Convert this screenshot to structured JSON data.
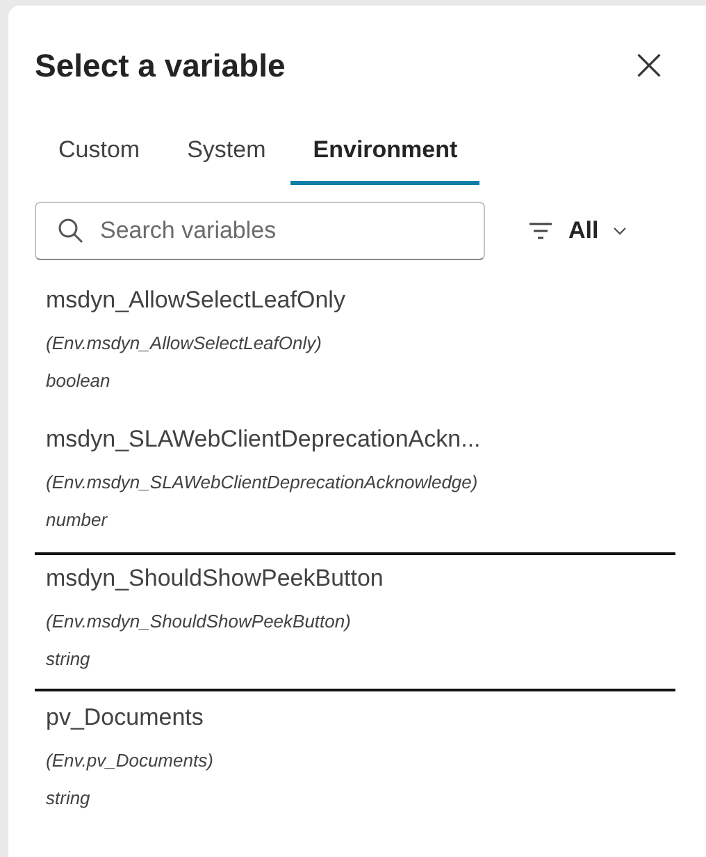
{
  "dialog": {
    "title": "Select a variable"
  },
  "tabs": [
    {
      "label": "Custom",
      "selected": false
    },
    {
      "label": "System",
      "selected": false
    },
    {
      "label": "Environment",
      "selected": true
    }
  ],
  "search": {
    "placeholder": "Search variables"
  },
  "filter": {
    "label": "All"
  },
  "variables": [
    {
      "name": "msdyn_AllowSelectLeafOnly",
      "reference": "(Env.msdyn_AllowSelectLeafOnly)",
      "type": "boolean",
      "selected": false
    },
    {
      "name": "msdyn_SLAWebClientDeprecationAckn...",
      "reference": "(Env.msdyn_SLAWebClientDeprecationAcknowledge)",
      "type": "number",
      "selected": false
    },
    {
      "name": "msdyn_ShouldShowPeekButton",
      "reference": "(Env.msdyn_ShouldShowPeekButton)",
      "type": "string",
      "selected": true
    },
    {
      "name": "pv_Documents",
      "reference": "(Env.pv_Documents)",
      "type": "string",
      "selected": false
    }
  ]
}
